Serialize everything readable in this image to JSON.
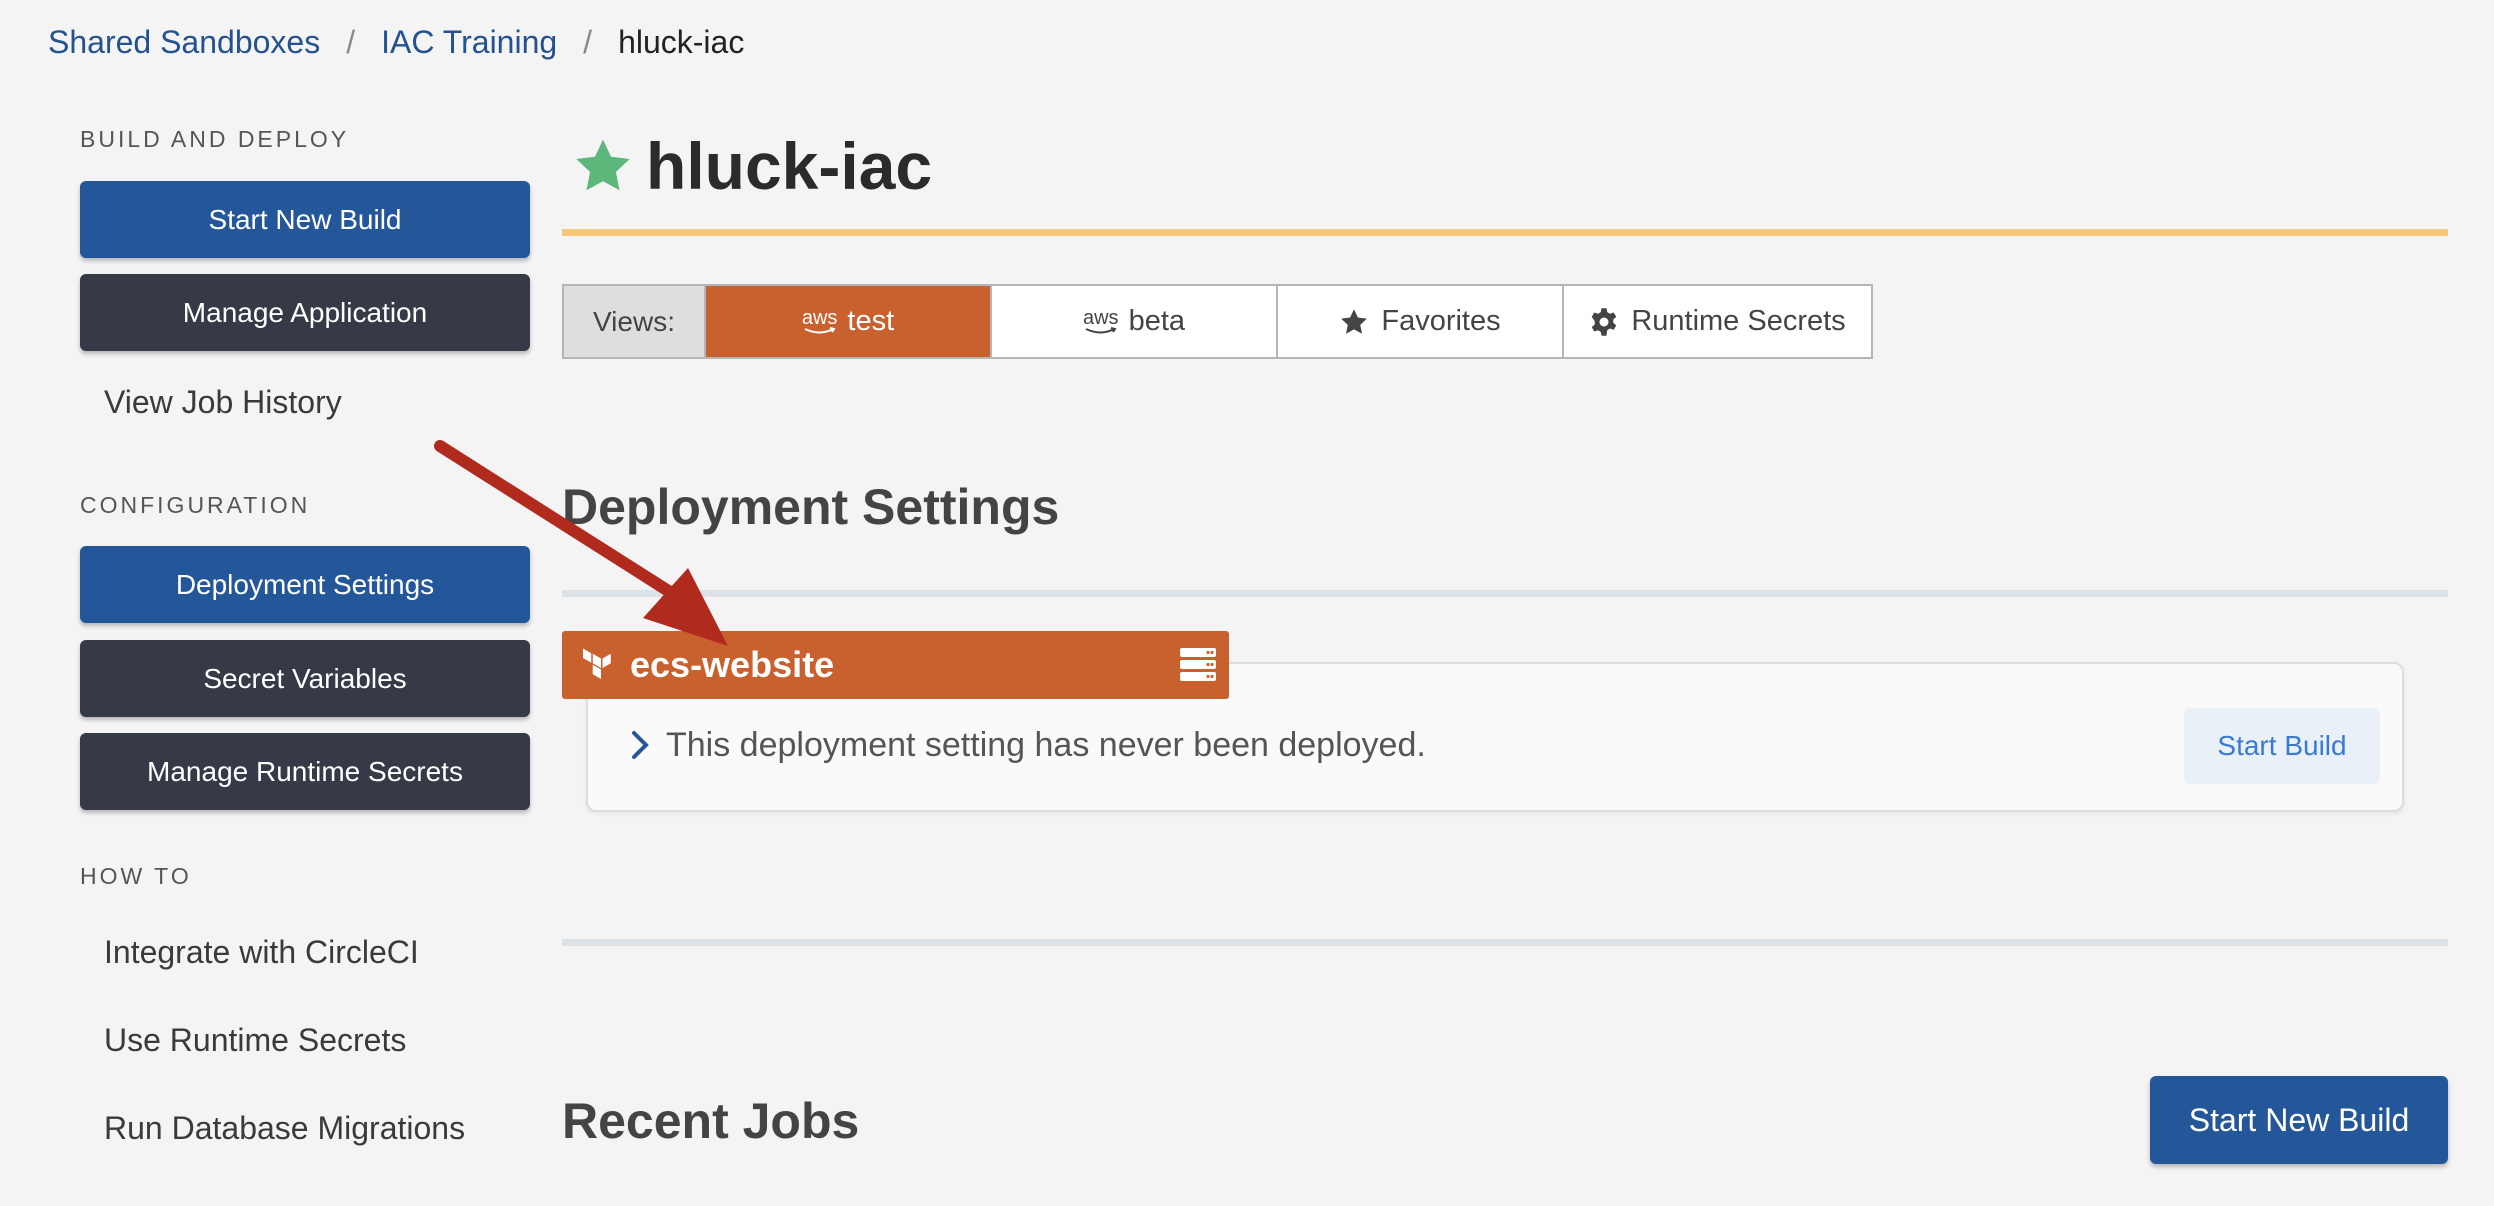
{
  "breadcrumb": {
    "items": [
      "Shared Sandboxes",
      "IAC Training"
    ],
    "separator": "/",
    "current": "hluck-iac"
  },
  "sidebar": {
    "build_and_deploy": {
      "label": "BUILD AND DEPLOY",
      "start_new_build": "Start New Build",
      "manage_application": "Manage Application",
      "view_job_history": "View Job History"
    },
    "configuration": {
      "label": "CONFIGURATION",
      "deployment_settings": "Deployment Settings",
      "secret_variables": "Secret Variables",
      "manage_runtime_secrets": "Manage Runtime Secrets"
    },
    "how_to": {
      "label": "HOW TO",
      "items": [
        "Integrate with CircleCI",
        "Use Runtime Secrets",
        "Run Database Migrations"
      ]
    }
  },
  "main": {
    "title": "hluck-iac",
    "views": {
      "label": "Views:",
      "aws_logo_text": "aws",
      "tabs": [
        {
          "label": "test",
          "icon": "aws-icon",
          "active": true
        },
        {
          "label": "beta",
          "icon": "aws-icon",
          "active": false
        },
        {
          "label": "Favorites",
          "icon": "star-icon",
          "active": false
        },
        {
          "label": "Runtime Secrets",
          "icon": "gear-icon",
          "active": false
        }
      ]
    },
    "deployment_settings": {
      "title": "Deployment Settings",
      "setting_name": "ecs-website",
      "status_message": "This deployment setting has never been deployed.",
      "start_build": "Start Build"
    },
    "recent_jobs": {
      "title": "Recent Jobs",
      "start_new_build": "Start New Build"
    }
  },
  "colors": {
    "brand_blue": "#24579a",
    "dark_button": "#353a46",
    "accent_orange": "#c9612f",
    "title_rule": "#f5c978",
    "favorite_star": "#5cb87a",
    "annotation_arrow": "#b02a1e"
  }
}
